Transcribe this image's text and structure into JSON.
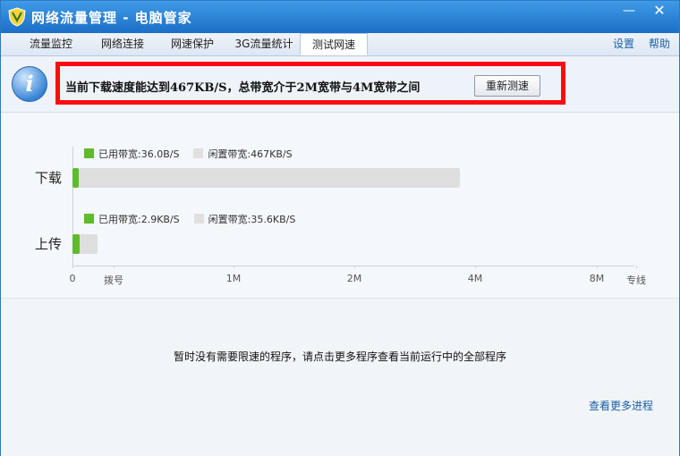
{
  "window": {
    "title": "网络流量管理 - 电脑管家",
    "minimize_glyph": "—",
    "close_glyph": "✕"
  },
  "tabs": [
    {
      "label": "流量监控"
    },
    {
      "label": "网络连接"
    },
    {
      "label": "网速保护"
    },
    {
      "label": "3G流量统计"
    },
    {
      "label": "测试网速",
      "active": true
    }
  ],
  "toplinks": {
    "settings": "设置",
    "help": "帮助"
  },
  "info": {
    "icon": "info-icon",
    "message": "当前下载速度能达到467KB/S，总带宽介于2M宽带与4M宽带之间",
    "retest_label": "重新测速"
  },
  "colors": {
    "used": "#5fbb2e",
    "idle": "#e0e0e0",
    "highlight": "#ff0a12",
    "accent": "#1c6fc7"
  },
  "chart_data": {
    "type": "bar",
    "categories": [
      "下载",
      "上传"
    ],
    "rows": [
      {
        "label": "下载",
        "used_label": "已用带宽:36.0B/S",
        "idle_label": "闲置带宽:467KB/S",
        "used_fraction": 0.003,
        "idle_fraction": 0.69
      },
      {
        "label": "上传",
        "used_label": "已用带宽:2.9KB/S",
        "idle_label": "闲置带宽:35.6KB/S",
        "used_fraction": 0.012,
        "idle_fraction": 0.044
      }
    ],
    "ticks": [
      "0",
      "拨号",
      "1M",
      "2M",
      "4M",
      "8M",
      "专线"
    ],
    "grid": false
  },
  "bottom": {
    "message": "暂时没有需要限速的程序，请点击更多程序查看当前运行中的全部程序",
    "more_link": "查看更多进程"
  }
}
